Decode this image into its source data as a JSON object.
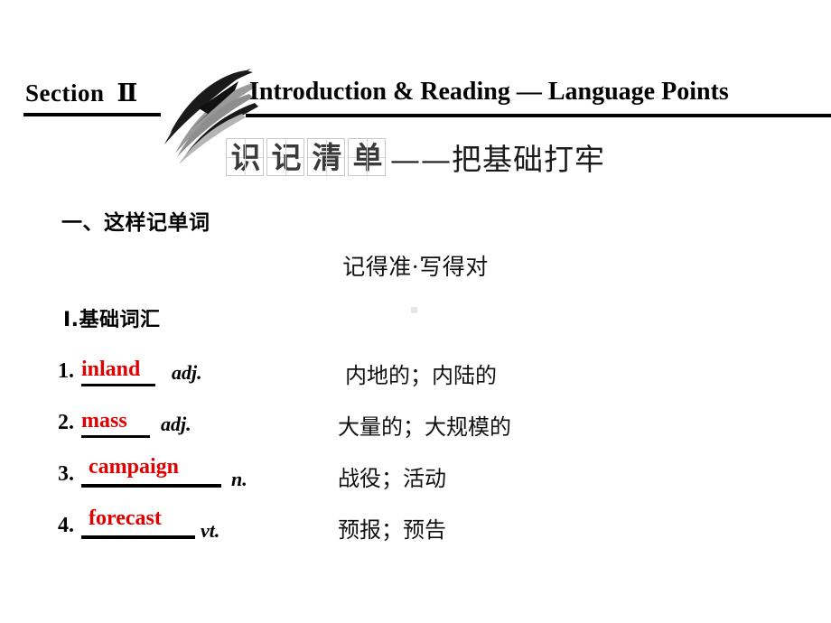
{
  "header": {
    "section_prefix": "Section",
    "section_number": "Ⅱ",
    "title": "Introduction & Reading — Language Points",
    "swoosh_icon": "swoosh-arrow-icon"
  },
  "boxed_heading": {
    "chars": [
      "识",
      "记",
      "清",
      "单"
    ],
    "tail": "——把基础打牢"
  },
  "sections": {
    "part_one": "一、这样记单词",
    "tagline": "记得准·写得对",
    "subsection": "Ⅰ.基础词汇"
  },
  "colors": {
    "answer_red": "#e00000",
    "text_black": "#000000",
    "cell_border": "#c9c9c9"
  },
  "vocabulary": [
    {
      "num": "1.",
      "word": "inland",
      "pos": "adj.",
      "cn": "内地的；内陆的"
    },
    {
      "num": "2.",
      "word": "mass",
      "pos": "adj.",
      "cn": "大量的；大规模的"
    },
    {
      "num": "3.",
      "word": "campaign",
      "pos": "n.",
      "cn": "战役；活动"
    },
    {
      "num": "4.",
      "word": "forecast",
      "pos": "vt.",
      "cn": "预报；预告"
    }
  ]
}
